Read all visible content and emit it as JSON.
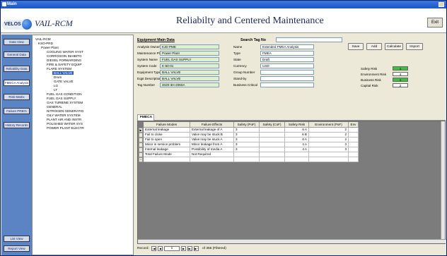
{
  "window": {
    "title": "Main"
  },
  "header": {
    "logo_text": "VELOS",
    "app_title": "VAIL-RCM",
    "main_title": "Reliabilty and Centered Maintenance",
    "exit_label": "Exit"
  },
  "nav": {
    "items": [
      "Data View",
      "General Data",
      "Reliability Data",
      "FMECA Analysis",
      "Risk Matrix",
      "Failure PRBI's",
      "History Records"
    ],
    "bottom": [
      "List View",
      "Report View"
    ]
  },
  "tree": {
    "nodes": [
      {
        "label": "VAIL-RCM",
        "indent": 0
      },
      {
        "label": "KSO-PRD",
        "indent": 1
      },
      {
        "label": "Power Plant",
        "indent": 2
      },
      {
        "label": "COOLING WATER SYST",
        "indent": 3
      },
      {
        "label": "CORROSION INHIBITO",
        "indent": 3
      },
      {
        "label": "DIESEL FORWARDING",
        "indent": 3
      },
      {
        "label": "FIRE & SAFETY EQUIP",
        "indent": 3
      },
      {
        "label": "FLARE SYSTEM",
        "indent": 3
      },
      {
        "label": "BALL VALVE",
        "indent": 4,
        "selected": true
      },
      {
        "label": "Drum",
        "indent": 4
      },
      {
        "label": "GATE VALVE",
        "indent": 4
      },
      {
        "label": "LG",
        "indent": 4
      },
      {
        "label": "LT",
        "indent": 4
      },
      {
        "label": "FUEL GAS CONDITION",
        "indent": 3
      },
      {
        "label": "FUEL GAS SUPPLY",
        "indent": 3
      },
      {
        "label": "GAS TURBINE SYSTEM",
        "indent": 3
      },
      {
        "label": "GENERAL",
        "indent": 3
      },
      {
        "label": "NITROGEN GENERATIO",
        "indent": 3
      },
      {
        "label": "OILY WATER SYSTEM",
        "indent": 3
      },
      {
        "label": "PLANT AIR AND INSTR",
        "indent": 3
      },
      {
        "label": "POLISHED WATER SYS",
        "indent": 3
      },
      {
        "label": "POWER PLANT ELECTR",
        "indent": 3
      }
    ]
  },
  "equipment": {
    "heading": "Equipment Main Data",
    "search_label": "Search Tag No",
    "left_fields": [
      {
        "label": "Analysis Owner",
        "value": "KJD PME"
      },
      {
        "label": "Maintenance Plan",
        "value": "Power Plant"
      },
      {
        "label": "System Name",
        "value": "FUEL GAS SUPPLY"
      },
      {
        "label": "System Code",
        "value": "K-50-01"
      },
      {
        "label": "Equipment Type",
        "value": "BALL VALVE"
      },
      {
        "label": "Eqpt Description",
        "value": "BALL VALVE"
      },
      {
        "label": "Tag Number",
        "value": "4020-3H-2060A"
      }
    ],
    "right_fields": [
      {
        "label": "Name",
        "value": "Extended FMEA Analysis"
      },
      {
        "label": "Type",
        "value": "FMEA"
      },
      {
        "label": "State",
        "value": "Draft"
      },
      {
        "label": "Currency",
        "value": "USD"
      },
      {
        "label": "Group Number",
        "value": ""
      },
      {
        "label": "Stand-by",
        "value": ""
      },
      {
        "label": "Business Critical",
        "value": ""
      }
    ],
    "buttons": [
      "Save",
      "Add",
      "Calculate",
      "Import"
    ],
    "risk": [
      {
        "label": "Safety Risk",
        "value": "1",
        "color": "#3fbf3f"
      },
      {
        "label": "Environment Risk",
        "value": "4",
        "color": "#ffffff"
      },
      {
        "label": "Business Risk",
        "value": "1",
        "color": "#3fbf3f"
      },
      {
        "label": "Capital Risk",
        "value": "2",
        "color": "#ffffff"
      }
    ]
  },
  "tab": {
    "label": "FMECA"
  },
  "grid": {
    "columns": [
      "Failure Modes",
      "Failure Effects",
      "Safety (PoF)",
      "Safety (CoF)",
      "Safety Risk",
      "Environment (PoF)",
      "Env"
    ],
    "rows": [
      [
        "External leakage",
        "External leakage of A",
        "3",
        "",
        "6 A",
        "2",
        ""
      ],
      [
        "Fail to close",
        "Valve may be stuck B",
        "3",
        "",
        "6 B",
        "2",
        ""
      ],
      [
        "Fail to open",
        "Valve may be stuck A",
        "3",
        "",
        "6 A",
        "2",
        ""
      ],
      [
        "Minor in service problem",
        "Minor leakage from A",
        "3",
        "",
        "4 A",
        "3",
        ""
      ],
      [
        "Internal leakage",
        "Possibility of media A",
        "3",
        "",
        "4 A",
        "3",
        ""
      ],
      [
        "Total Failure Mode",
        "Not Required",
        "",
        "",
        "",
        "",
        ""
      ],
      [
        "",
        "",
        "",
        "",
        "",
        "",
        ""
      ]
    ]
  },
  "record_bar": {
    "label": "Record:",
    "current": "1",
    "of_text": "of 355 (Filtered)"
  }
}
